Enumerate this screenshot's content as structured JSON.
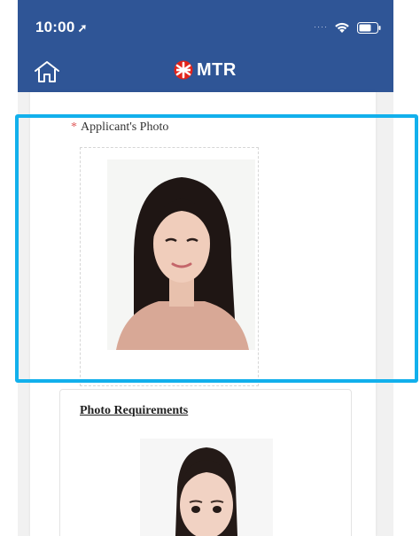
{
  "status_bar": {
    "time": "10:00",
    "location_arrow": "➤"
  },
  "header": {
    "logo_text": "MTR",
    "background_color": "#2f5596",
    "home_icon": "home-icon"
  },
  "form": {
    "required_marker": "*",
    "photo_label": "Applicant's Photo",
    "highlight_color": "#12b0ec"
  },
  "requirements": {
    "title": "Photo Requirements"
  }
}
